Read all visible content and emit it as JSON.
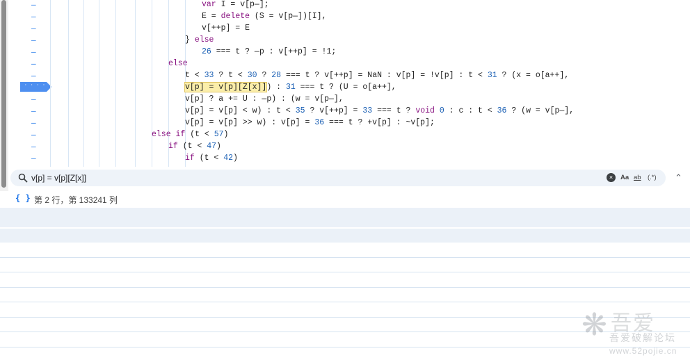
{
  "editor": {
    "gutter_markers": [
      "–",
      "–",
      "–",
      "–",
      "–",
      "–",
      "–",
      "",
      "–",
      "–",
      "–",
      "–",
      "–",
      "–"
    ],
    "breakpoint_dots": "· · · ·",
    "code_lines": [
      {
        "indent": 290,
        "tokens": [
          {
            "t": "kw",
            "v": "var"
          },
          {
            "t": "",
            "v": " I = v[p—];"
          }
        ]
      },
      {
        "indent": 290,
        "tokens": [
          {
            "t": "",
            "v": "E = "
          },
          {
            "t": "kw",
            "v": "delete"
          },
          {
            "t": "",
            "v": " (S = v[p—])[I],"
          }
        ]
      },
      {
        "indent": 290,
        "tokens": [
          {
            "t": "",
            "v": "v[++p] = E"
          }
        ]
      },
      {
        "indent": 266,
        "tokens": [
          {
            "t": "",
            "v": "} "
          },
          {
            "t": "kw",
            "v": "else"
          }
        ]
      },
      {
        "indent": 290,
        "tokens": [
          {
            "t": "num",
            "v": "26"
          },
          {
            "t": "",
            "v": " === t ? —p : v[++p] = !1;"
          }
        ]
      },
      {
        "indent": 242,
        "tokens": [
          {
            "t": "kw",
            "v": "else"
          }
        ]
      },
      {
        "indent": 266,
        "tokens": [
          {
            "t": "",
            "v": "t < "
          },
          {
            "t": "num",
            "v": "33"
          },
          {
            "t": "",
            "v": " ? t < "
          },
          {
            "t": "num",
            "v": "30"
          },
          {
            "t": "",
            "v": " ? "
          },
          {
            "t": "num",
            "v": "28"
          },
          {
            "t": "",
            "v": " === t ? v[++p] = NaN : v[p] = !v[p] : t < "
          },
          {
            "t": "num",
            "v": "31"
          },
          {
            "t": "",
            "v": " ? (x = o[a++],"
          }
        ]
      },
      {
        "indent": 266,
        "tokens": [
          {
            "t": "hl",
            "v": "v[p] = v[p][Z[x]]"
          },
          {
            "t": "",
            "v": ") : "
          },
          {
            "t": "num",
            "v": "31"
          },
          {
            "t": "",
            "v": " === t ? (U = o[a++],"
          }
        ]
      },
      {
        "indent": 266,
        "tokens": [
          {
            "t": "",
            "v": "v[p] ? a += U : —p) : (w = v[p—],"
          }
        ]
      },
      {
        "indent": 266,
        "tokens": [
          {
            "t": "",
            "v": "v[p] = v[p] < w) : t < "
          },
          {
            "t": "num",
            "v": "35"
          },
          {
            "t": "",
            "v": " ? v[++p] = "
          },
          {
            "t": "num",
            "v": "33"
          },
          {
            "t": "",
            "v": " === t ? "
          },
          {
            "t": "kw",
            "v": "void"
          },
          {
            "t": "",
            "v": " "
          },
          {
            "t": "num",
            "v": "0"
          },
          {
            "t": "",
            "v": " : c : t < "
          },
          {
            "t": "num",
            "v": "36"
          },
          {
            "t": "",
            "v": " ? (w = v[p—],"
          }
        ]
      },
      {
        "indent": 266,
        "tokens": [
          {
            "t": "",
            "v": "v[p] = v[p] >> w) : v[p] = "
          },
          {
            "t": "num",
            "v": "36"
          },
          {
            "t": "",
            "v": " === t ? +v[p] : ~v[p];"
          }
        ]
      },
      {
        "indent": 218,
        "tokens": [
          {
            "t": "kw",
            "v": "else if"
          },
          {
            "t": "",
            "v": " (t < "
          },
          {
            "t": "num",
            "v": "57"
          },
          {
            "t": "",
            "v": ")"
          }
        ]
      },
      {
        "indent": 242,
        "tokens": [
          {
            "t": "kw",
            "v": "if"
          },
          {
            "t": "",
            "v": " (t < "
          },
          {
            "t": "num",
            "v": "47"
          },
          {
            "t": "",
            "v": ")"
          }
        ]
      },
      {
        "indent": 266,
        "tokens": [
          {
            "t": "kw",
            "v": "if"
          },
          {
            "t": "",
            "v": " (t < "
          },
          {
            "t": "num",
            "v": "42"
          },
          {
            "t": "",
            "v": ")"
          }
        ]
      }
    ]
  },
  "search": {
    "query": "v[p] = v[p][Z[x]]",
    "clear_symbol": "×",
    "match_case_label": "Aa",
    "whole_word_label": "ab",
    "regex_label": "(.*)",
    "close_symbol": "⌃"
  },
  "status": {
    "icon_text": "{ }",
    "position_text": "第 2 行，第 133241 列"
  },
  "watermark": {
    "title": "吾爱",
    "subtitle": "吾爱破解论坛",
    "url": "www.52pojie.cn"
  },
  "colors": {
    "keyword": "#881280",
    "number": "#1a5fb4",
    "highlight": "#fbeeaa",
    "accent": "#1a73e8"
  }
}
